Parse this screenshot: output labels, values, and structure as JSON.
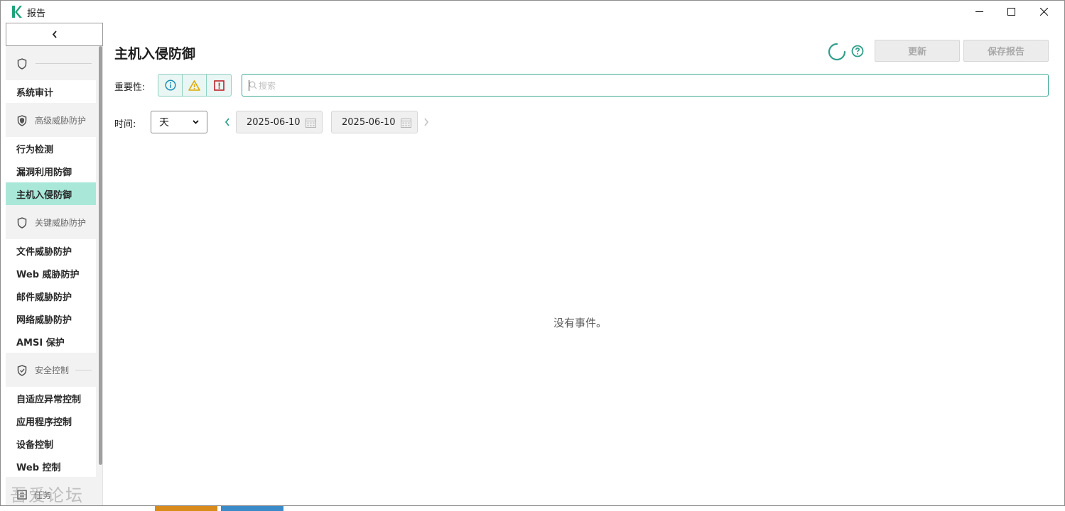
{
  "window": {
    "title": "报告"
  },
  "sidebar": {
    "groups": [
      {
        "label": "",
        "icon": "shield-icon",
        "items": [
          "系统审计"
        ]
      },
      {
        "label": "高级威胁防护",
        "icon": "shield-filled-icon",
        "items": [
          "行为检测",
          "漏洞利用防御",
          "主机入侵防御"
        ]
      },
      {
        "label": "关键威胁防护",
        "icon": "shield-icon",
        "items": [
          "文件威胁防护",
          "Web 威胁防护",
          "邮件威胁防护",
          "网络威胁防护",
          "AMSI 保护"
        ]
      },
      {
        "label": "安全控制",
        "icon": "shield-check-icon",
        "items": [
          "自适应异常控制",
          "应用程序控制",
          "设备控制",
          "Web 控制"
        ]
      }
    ],
    "active_item": "主机入侵防御",
    "bottom_label": "任务"
  },
  "main": {
    "title": "主机入侵防御",
    "refresh_label": "更新",
    "save_label": "保存报告",
    "severity_label": "重要性:",
    "search_placeholder": "搜索",
    "time_label": "时间:",
    "period_value": "天",
    "date_from": "2025-06-10",
    "date_to": "2025-06-10",
    "empty_message": "没有事件。"
  },
  "watermark": "吾爱论坛",
  "colors": {
    "accent": "#2f9e8b",
    "active_bg": "#a9e8d9",
    "info": "#1f8fb8",
    "warning": "#e0a800",
    "critical": "#c0202a"
  }
}
